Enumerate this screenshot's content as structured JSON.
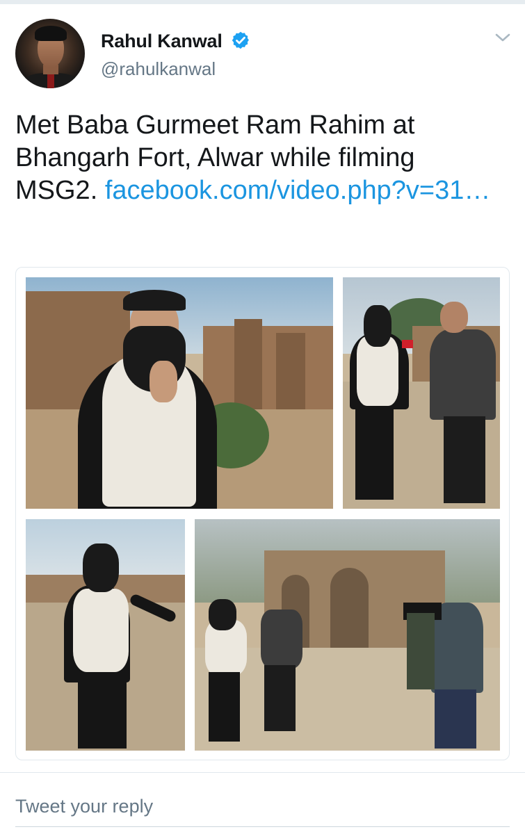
{
  "tweet": {
    "author_name": "Rahul Kanwal",
    "author_handle": "@rahulkanwal",
    "verified_icon": "verified-badge-icon",
    "menu_icon": "chevron-down-icon",
    "text": "Met Baba Gurmeet Ram Rahim at Bhangarh Fort, Alwar while filming MSG2.",
    "link_text": "facebook.com/video.php?v=31…"
  },
  "media": {
    "photo_count": 4
  },
  "reply": {
    "placeholder": "Tweet your reply"
  },
  "colors": {
    "link": "#1b95e0",
    "verified": "#1da1f2",
    "secondary_text": "#657786",
    "divider": "#e1e8ed"
  }
}
